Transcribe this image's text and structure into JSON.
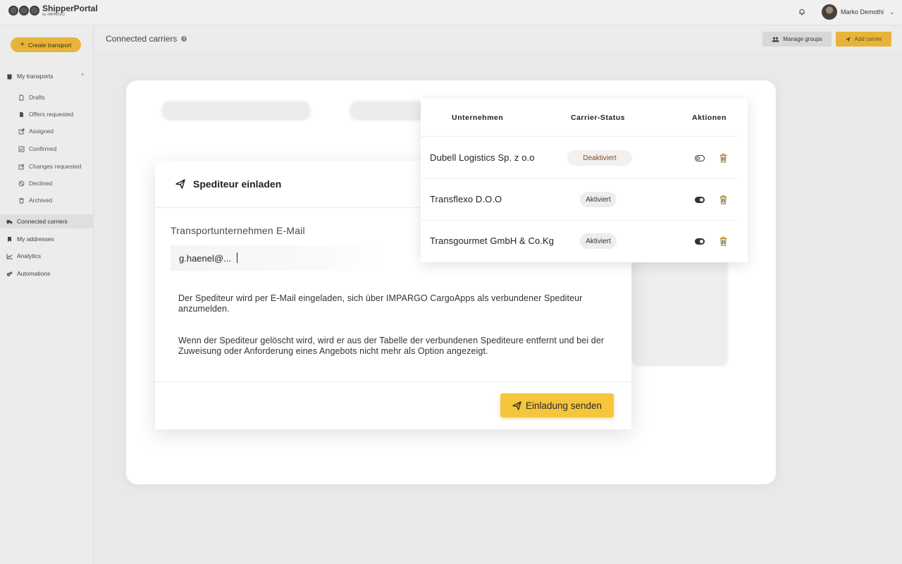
{
  "app": {
    "brand": "ShipperPortal",
    "brand_sub": "by IMPARGO",
    "user_name": "Marko Demothi"
  },
  "sidebar": {
    "create_label": "Create transport",
    "section_label": "My transports",
    "sub_items": [
      {
        "label": "Drafts",
        "icon": "file-icon"
      },
      {
        "label": "Offers requested",
        "icon": "file-text-icon"
      },
      {
        "label": "Assigned",
        "icon": "share-icon"
      },
      {
        "label": "Confirmed",
        "icon": "check-square-icon"
      },
      {
        "label": "Changes requested",
        "icon": "edit-icon"
      },
      {
        "label": "Declined",
        "icon": "ban-icon"
      },
      {
        "label": "Archived",
        "icon": "trash-icon"
      }
    ],
    "main_items": [
      {
        "label": "Connected carriers",
        "icon": "truck-icon",
        "active": true
      },
      {
        "label": "My addresses",
        "icon": "bookmark-icon"
      },
      {
        "label": "Analytics",
        "icon": "chart-line-icon"
      },
      {
        "label": "Automations",
        "icon": "cogs-icon"
      }
    ]
  },
  "header": {
    "title": "Connected carriers",
    "manage_groups": "Manage groups",
    "add_carrier": "Add carrier"
  },
  "invite_modal": {
    "title": "Spediteur einladen",
    "field_label": "Transportunternehmen E-Mail",
    "email_value": "g.haenel@...",
    "paragraph_1": "Der Spediteur wird per E-Mail eingeladen, sich über IMPARGO CargoApps als verbundener Spediteur anzumelden.",
    "paragraph_2": "Wenn der Spediteur gelöscht wird, wird er aus der Tabelle der verbundenen Spediteure entfernt und bei der Zuweisung oder Anforderung eines Angebots nicht mehr als Option angezeigt.",
    "send_label": "Einladung senden"
  },
  "carriers_table": {
    "headers": {
      "company": "Unternehmen",
      "status": "Carrier-Status",
      "actions": "Aktionen"
    },
    "rows": [
      {
        "company": "Dubell Logistics Sp. z o.o",
        "status": "Deaktiviert",
        "active": false
      },
      {
        "company": "Transflexo D.O.O",
        "status": "Aktiviert",
        "active": true
      },
      {
        "company": "Transgourmet GmbH & Co.Kg",
        "status": "Aktiviert",
        "active": true
      }
    ]
  },
  "colors": {
    "accent": "#f5c53c",
    "accent_dim": "#e6b43a",
    "deactivated_text": "#7a4a2a",
    "trash_icon": "#b8860b"
  }
}
